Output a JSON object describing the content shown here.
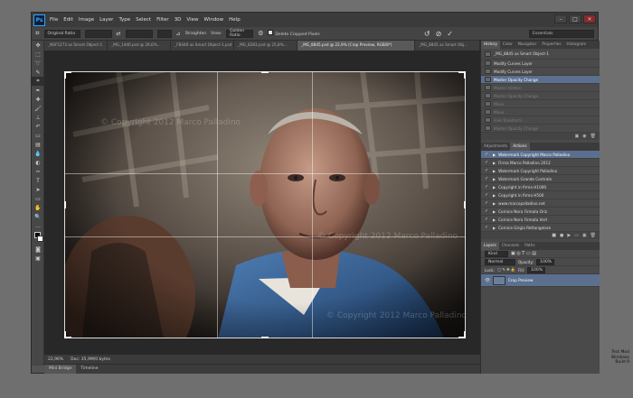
{
  "app": {
    "logo": "Ps"
  },
  "menu": [
    "File",
    "Edit",
    "Image",
    "Layer",
    "Type",
    "Select",
    "Filter",
    "3D",
    "View",
    "Window",
    "Help"
  ],
  "options_bar": {
    "ratio": "Original Ratio",
    "straighten_label": "Straighten",
    "view_label": "View:",
    "view_value": "Golden Ratio",
    "delete_cropped_label": "Delete Cropped Pixels",
    "workspace": "Essentials"
  },
  "doc_tabs": [
    "_NSF5273 as Smart Object-1",
    "_MG_1440.psd @ 29,6%...",
    "_FB448 as Smart Object-1.psd",
    "_MG_8283.psd @ 25,8%...",
    "_MG_8845.psd @ 22,9% (Crop Preview, RGB/8*)",
    "_MG_8845 as Smart Obj..."
  ],
  "watermark_text": "© Copyright 2012 Marco Palladino",
  "status": {
    "zoom": "22,96%",
    "doc": "Doc: 35,9M/0 bytes"
  },
  "bottom_tabs": [
    "Mini Bridge",
    "Timeline"
  ],
  "history": {
    "tabs": [
      "History",
      "Color",
      "Navigator",
      "Properties",
      "Histogram"
    ],
    "snapshot": "_MG_8845 as Smart Object-1",
    "items": [
      {
        "label": "Modify Curves Layer",
        "state": "normal"
      },
      {
        "label": "Modify Curves Layer",
        "state": "normal"
      },
      {
        "label": "Master Opacity Change",
        "state": "selected"
      },
      {
        "label": "Master Hidden",
        "state": "dim"
      },
      {
        "label": "Master Opacity Change",
        "state": "dim"
      },
      {
        "label": "Move",
        "state": "dim"
      },
      {
        "label": "Move",
        "state": "dim"
      },
      {
        "label": "Free Transform",
        "state": "dim"
      },
      {
        "label": "Master Opacity Change",
        "state": "dim"
      }
    ]
  },
  "actions": {
    "tabs": [
      "Adjustments",
      "Actions"
    ],
    "items": [
      {
        "label": "Watermark Copyright Marco Palladino",
        "state": "selected"
      },
      {
        "label": "Firma Marco Palladino 2012",
        "state": "normal"
      },
      {
        "label": "Watermark Copyright Palladino",
        "state": "normal"
      },
      {
        "label": "Watermark Grande Centrale",
        "state": "normal"
      },
      {
        "label": "Copyright in firma H1000",
        "state": "normal"
      },
      {
        "label": "Copyright in firma H500",
        "state": "normal"
      },
      {
        "label": "www.marcopalladino.net",
        "state": "normal"
      },
      {
        "label": "Cornice Nera Firmata Oriz",
        "state": "normal"
      },
      {
        "label": "Cornice Nera Firmata Vert",
        "state": "normal"
      },
      {
        "label": "Cornice Grigia Rettangolare",
        "state": "normal"
      }
    ]
  },
  "layers": {
    "tabs": [
      "Layers",
      "Channels",
      "Paths"
    ],
    "kind": "Kind",
    "blend": "Normal",
    "opacity_label": "Opacity:",
    "opacity": "100%",
    "lock_label": "Lock:",
    "fill_label": "Fill:",
    "fill": "100%",
    "layer_name": "Crop Preview"
  },
  "corner_text": [
    "Test Mod",
    "Windows",
    "Build 9"
  ],
  "colors": {
    "accent": "#5b6f8f",
    "logo_blue": "#31a8ff"
  }
}
